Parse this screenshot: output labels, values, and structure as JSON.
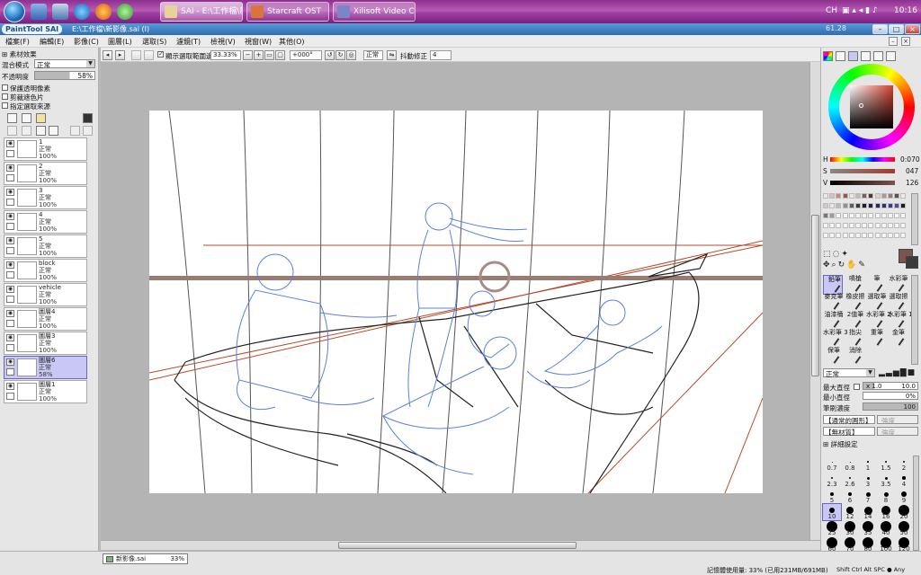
{
  "taskbar": {
    "tasks": [
      {
        "label": "SAI - E:\\工作檔\\新...",
        "active": true
      },
      {
        "label": "Starcraft OST",
        "active": false
      },
      {
        "label": "Xilisoft Video Co...",
        "active": false
      }
    ],
    "tray": {
      "lang": "CH",
      "time": "10:16"
    }
  },
  "window": {
    "app_logo": "PaintTool SAI",
    "title": "E:\\工作檔\\新影像.sai (I)",
    "brand": "61.28"
  },
  "menu": [
    "檔案(F)",
    "編輯(E)",
    "影像(C)",
    "圖層(L)",
    "選取(S)",
    "濾鏡(T)",
    "檢視(V)",
    "視窗(W)",
    "其他(O)"
  ],
  "left_panel": {
    "material_effect": "素材效果",
    "blend_label": "混合模式",
    "blend_value": "正常",
    "opacity_label": "不透明度",
    "opacity_value": "58%",
    "checkboxes": [
      "保護透明像素",
      "剪裁遮色片",
      "指定選取來源"
    ],
    "layers": [
      {
        "name": "1",
        "mode": "正常",
        "opacity": "100%",
        "selected": false
      },
      {
        "name": "2",
        "mode": "正常",
        "opacity": "100%",
        "selected": false
      },
      {
        "name": "3",
        "mode": "正常",
        "opacity": "100%",
        "selected": false
      },
      {
        "name": "4",
        "mode": "正常",
        "opacity": "100%",
        "selected": false
      },
      {
        "name": "5",
        "mode": "正常",
        "opacity": "100%",
        "selected": false
      },
      {
        "name": "block",
        "mode": "正常",
        "opacity": "100%",
        "selected": false
      },
      {
        "name": "vehicle",
        "mode": "正常",
        "opacity": "100%",
        "selected": false
      },
      {
        "name": "圖層4",
        "mode": "正常",
        "opacity": "100%",
        "selected": false
      },
      {
        "name": "圖層3",
        "mode": "正常",
        "opacity": "100%",
        "selected": false
      },
      {
        "name": "圖層6",
        "mode": "正常",
        "opacity": "58%",
        "selected": true
      },
      {
        "name": "圖層1",
        "mode": "正常",
        "opacity": "100%",
        "selected": false
      }
    ]
  },
  "toolbar": {
    "selection_checkbox": "顯示選取範圍邊緣",
    "zoom": "33.33%",
    "angle": "+000°",
    "mode": "正常",
    "stabilizer_label": "抖動修正",
    "stabilizer_value": "4"
  },
  "right_panel": {
    "hsv": [
      {
        "label": "H",
        "value": "0:070"
      },
      {
        "label": "S",
        "value": "047"
      },
      {
        "label": "V",
        "value": "126"
      }
    ],
    "tools": [
      {
        "label": "鉛筆",
        "selected": true
      },
      {
        "label": "噴槍",
        "selected": false
      },
      {
        "label": "筆",
        "selected": false
      },
      {
        "label": "水彩筆",
        "selected": false
      },
      {
        "label": "麥克筆",
        "selected": false
      },
      {
        "label": "橡皮擦",
        "selected": false
      },
      {
        "label": "選取筆",
        "selected": false
      },
      {
        "label": "選取擦",
        "selected": false
      },
      {
        "label": "油漆桶",
        "selected": false
      },
      {
        "label": "2值筆",
        "selected": false
      },
      {
        "label": "水彩筆 2",
        "selected": false
      },
      {
        "label": "水彩筆 1",
        "selected": false
      },
      {
        "label": "水彩筆 3",
        "selected": false
      },
      {
        "label": "指尖",
        "selected": false
      },
      {
        "label": "重筆",
        "selected": false
      },
      {
        "label": "金筆",
        "selected": false
      },
      {
        "label": "保筆",
        "selected": false
      },
      {
        "label": "消除",
        "selected": false
      }
    ],
    "brush_mode": "正常",
    "max_size_label": "最大直徑",
    "max_size_mult": "x 1.0",
    "max_size_value": "10.0",
    "min_size_label": "最小直徑",
    "min_size_value": "0%",
    "density_label": "筆刷濃度",
    "density_value": "100",
    "shape1": "【通常的圓形】",
    "shape1_strength": "強度",
    "shape2": "【無材質】",
    "shape2_strength": "強度",
    "detail_settings": "詳細設定",
    "brush_sizes": [
      "0.7",
      "0.8",
      "1",
      "1.5",
      "2",
      "2.3",
      "2.6",
      "3",
      "3.5",
      "4",
      "5",
      "6",
      "7",
      "8",
      "9",
      "10",
      "12",
      "14",
      "16",
      "20",
      "25",
      "30",
      "35",
      "40",
      "50",
      "60",
      "70",
      "80",
      "100",
      "120"
    ],
    "selected_brush_size": "10"
  },
  "status": {
    "doc_tab": "新影像.sai",
    "doc_zoom": "33%",
    "memory": "記憶體使用量: 33% (已用231MB/691MB)",
    "keys": "Shift Ctrl Alt SPC ● Any"
  },
  "colors": {
    "main_color": "#7a5550",
    "sub_color": "#3b3b3b",
    "sketch_blue": "#5b82d9",
    "guide_red": "#b54a2c"
  }
}
